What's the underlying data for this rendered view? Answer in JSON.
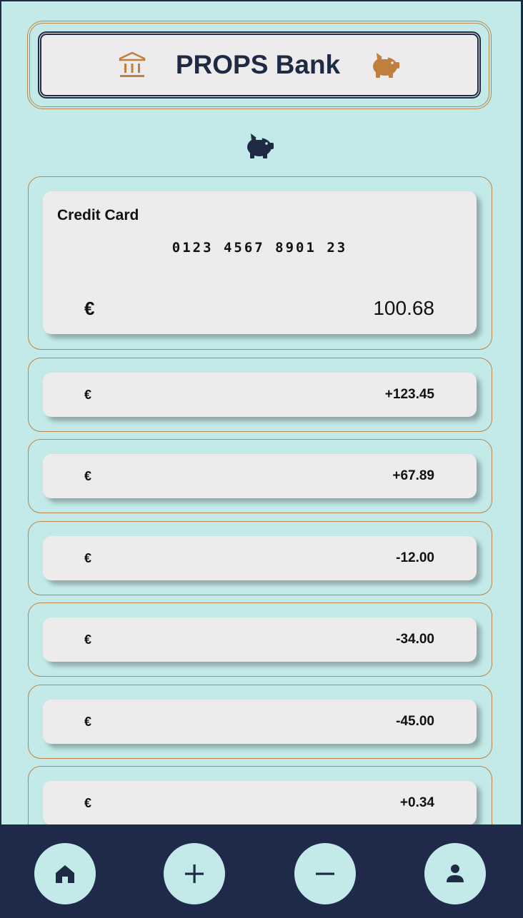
{
  "header": {
    "title": "PROPS Bank",
    "left_icon": "bank-icon",
    "right_icon": "piggy-bank-icon"
  },
  "center_icon": "piggy-bank-icon",
  "account": {
    "title": "Credit Card",
    "number": "0123 4567 8901 23",
    "currency": "€",
    "balance": "100.68"
  },
  "transactions": [
    {
      "currency": "€",
      "amount": "+123.45"
    },
    {
      "currency": "€",
      "amount": "+67.89"
    },
    {
      "currency": "€",
      "amount": "-12.00"
    },
    {
      "currency": "€",
      "amount": "-34.00"
    },
    {
      "currency": "€",
      "amount": "-45.00"
    },
    {
      "currency": "€",
      "amount": "+0.34"
    }
  ],
  "nav": {
    "items": [
      {
        "icon": "home-icon"
      },
      {
        "icon": "plus-icon"
      },
      {
        "icon": "minus-icon"
      },
      {
        "icon": "person-icon"
      }
    ]
  },
  "colors": {
    "background": "#c3eae9",
    "navy": "#1f2a44",
    "accent": "#b98549",
    "card": "#edebec"
  }
}
